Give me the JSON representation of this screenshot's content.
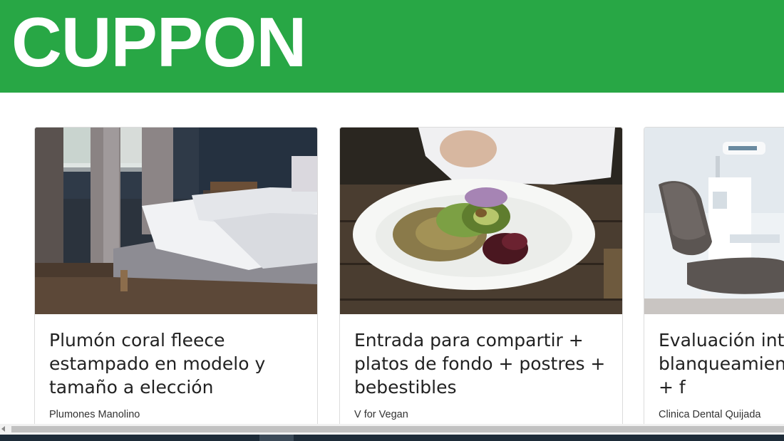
{
  "header": {
    "logo_text": "CUPPON",
    "color": "#28a745"
  },
  "cards": [
    {
      "title": "Plumón coral fleece estampado en modelo y tamaño a elección",
      "vendor": "Plumones Manolino",
      "image": "bedroom-photo"
    },
    {
      "title": "Entrada para compartir + platos de fondo + postres + bebestibles",
      "vendor": "V for Vegan",
      "image": "vegan-salad-photo"
    },
    {
      "title": "Evaluación integral + blanqueamiento + limpieza + f",
      "vendor": "Clinica Dental Quijada",
      "image": "dental-chair-photo"
    }
  ]
}
